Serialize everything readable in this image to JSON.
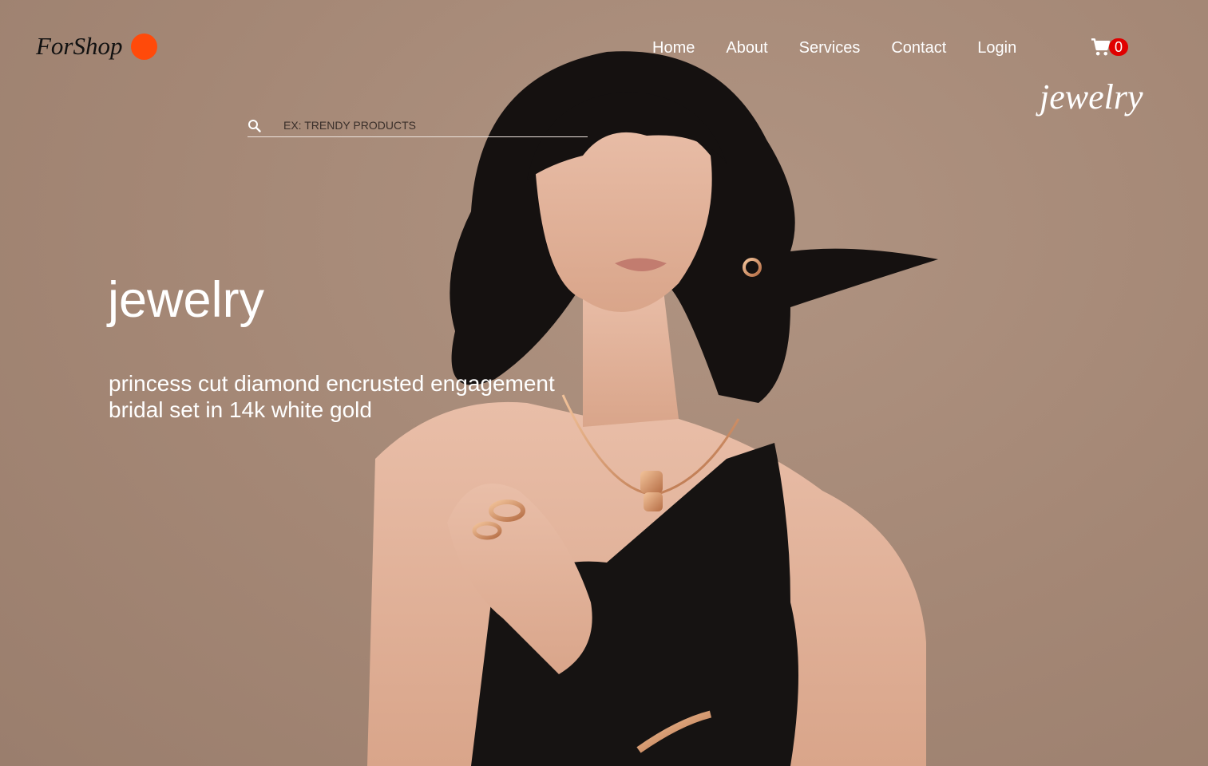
{
  "brand": {
    "name": "ForShop",
    "dot_color": "#ff4a0a"
  },
  "nav": {
    "items": [
      {
        "label": "Home"
      },
      {
        "label": "About"
      },
      {
        "label": "Services"
      },
      {
        "label": "Contact"
      },
      {
        "label": "Login"
      }
    ]
  },
  "cart": {
    "icon": "cart-icon",
    "count": "0",
    "badge_color": "#e00000"
  },
  "header_tag": "jewelry",
  "search": {
    "icon": "search-icon",
    "placeholder": "EX: TRENDY PRODUCTS",
    "value": ""
  },
  "hero": {
    "title": "jewelry",
    "subtitle_line1": "princess cut diamond encrusted engagement",
    "subtitle_line2": "bridal set in 14k white gold",
    "image": "model-wearing-jewelry-photo"
  },
  "colors": {
    "background": "#a48775",
    "text": "#ffffff"
  }
}
